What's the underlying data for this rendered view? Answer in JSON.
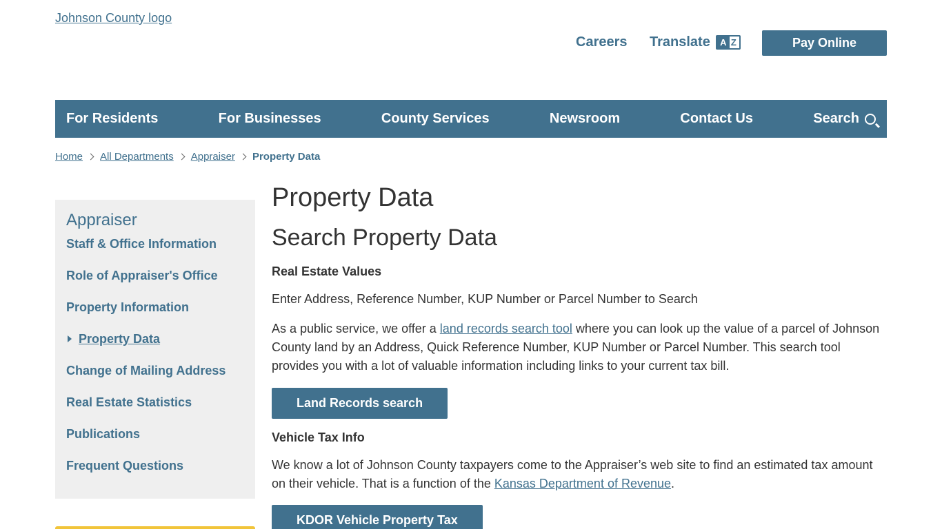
{
  "header": {
    "logo_alt": "Johnson County logo",
    "careers_label": "Careers",
    "translate_label": "Translate",
    "translate_icon": "translate-az-icon",
    "pay_label": "Pay Online"
  },
  "nav": {
    "items": [
      {
        "label": "For Residents"
      },
      {
        "label": "For Businesses"
      },
      {
        "label": "County Services"
      },
      {
        "label": "Newsroom"
      },
      {
        "label": "Contact Us"
      },
      {
        "label": "Search"
      }
    ]
  },
  "breadcrumb": {
    "items": [
      "Home",
      "All Departments",
      "Appraiser"
    ],
    "current": "Property Data"
  },
  "sidebar": {
    "title": "Appraiser",
    "items": [
      {
        "label": "Staff & Office Information"
      },
      {
        "label": "Role of Appraiser's Office"
      },
      {
        "label": "Property Information"
      },
      {
        "label": "Property Data"
      },
      {
        "label": "Change of Mailing Address"
      },
      {
        "label": "Real Estate Statistics"
      },
      {
        "label": "Publications"
      },
      {
        "label": "Frequent Questions"
      }
    ]
  },
  "content": {
    "title": "Property Data",
    "section_title": "Search Property Data",
    "real_estate": {
      "heading": "Real Estate Values",
      "intro": "Enter Address, Reference Number, KUP Number or Parcel Number to Search",
      "body_before": "As a public service, we offer a ",
      "body_link": "land records search tool",
      "body_after": " where you can look up the value of a parcel of Johnson County land by an Address, Quick Reference Number, KUP Number or Parcel Number. This search tool provides you with a lot of valuable information including links to your current tax bill.",
      "button_label": "Land Records search"
    },
    "vehicle": {
      "heading": "Vehicle Tax Info",
      "body_before": "We know a lot of Johnson County taxpayers come to the Appraiser’s web site to find an estimated tax amount on their vehicle. That is a function of the ",
      "body_link": "Kansas Department of Revenue",
      "body_after": ".",
      "button_label": "KDOR Vehicle Property Tax"
    }
  },
  "colors": {
    "brand": "#41718e",
    "sidebar_bg": "#efefef",
    "accent_yellow": "#f1c43a"
  }
}
